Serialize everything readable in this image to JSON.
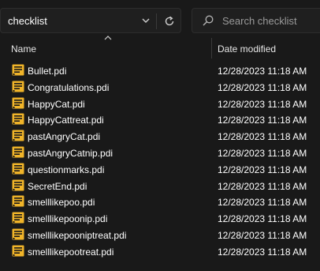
{
  "address_bar": {
    "path": "checklist"
  },
  "search": {
    "placeholder": "Search checklist"
  },
  "columns": {
    "name": "Name",
    "date_modified": "Date modified"
  },
  "files": [
    {
      "name": "Bullet.pdi",
      "date": "12/28/2023 11:18 AM"
    },
    {
      "name": "Congratulations.pdi",
      "date": "12/28/2023 11:18 AM"
    },
    {
      "name": "HappyCat.pdi",
      "date": "12/28/2023 11:18 AM"
    },
    {
      "name": "HappyCattreat.pdi",
      "date": "12/28/2023 11:18 AM"
    },
    {
      "name": "pastAngryCat.pdi",
      "date": "12/28/2023 11:18 AM"
    },
    {
      "name": "pastAngryCatnip.pdi",
      "date": "12/28/2023 11:18 AM"
    },
    {
      "name": "questionmarks.pdi",
      "date": "12/28/2023 11:18 AM"
    },
    {
      "name": "SecretEnd.pdi",
      "date": "12/28/2023 11:18 AM"
    },
    {
      "name": "smelllikepoo.pdi",
      "date": "12/28/2023 11:18 AM"
    },
    {
      "name": "smelllikepoonip.pdi",
      "date": "12/28/2023 11:18 AM"
    },
    {
      "name": "smelllikepooniptreat.pdi",
      "date": "12/28/2023 11:18 AM"
    },
    {
      "name": "smelllikepootreat.pdi",
      "date": "12/28/2023 11:18 AM"
    }
  ],
  "icons": {
    "file": "file-pdi-icon",
    "chevron": "chevron-down-icon",
    "refresh": "refresh-icon",
    "search": "search-icon",
    "sort": "sort-ascending-icon"
  },
  "colors": {
    "background": "#191919",
    "file_icon": "#f0b429"
  }
}
